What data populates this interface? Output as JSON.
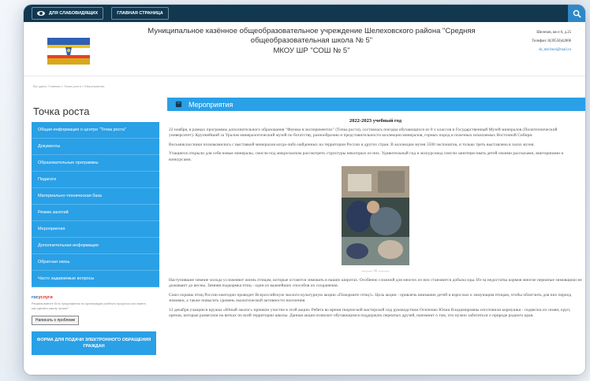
{
  "topbar": {
    "accessibility_label": "ДЛЯ СЛАБОВИДЯЩИХ",
    "home_label": "ГЛАВНАЯ СТРАНИЦА"
  },
  "header": {
    "school_name": "Муниципальное казённое общеобразовательное учреждение Шелеховского района \"Средняя общеобразовательная школа № 5\"",
    "short_name": "МКОУ ШР \"СОШ № 5\"",
    "address": "Шелехов, кв-л 6, д.25",
    "phone": "Телефон: 8(39550)42806",
    "email": "sh_mschool@mail.ru"
  },
  "breadcrumb": "Вы здесь: Главная  »  Точка роста  »  Мероприятия",
  "sidebar": {
    "title": "Точка роста",
    "items": [
      "Общая информация о центре \"Точка роста\"",
      "Документы",
      "Образовательные программы",
      "Педагоги",
      "Материально-техническая база",
      "Режим занятий",
      "Мероприятия",
      "Дополнительная информация",
      "Обратная связь",
      "Часто задаваемые вопросы"
    ],
    "gos_part1": "гос",
    "gos_part2": "услуги",
    "gos_text": "Решаем вместе\nЕсть предложения по организации учебного процесса или знаете, как сделать школу лучше?",
    "write_button": "Написать о проблеме",
    "feedback_button": "ФОРМА ДЛЯ ПОДАЧИ ЭЛЕКТРОННОГО ОБРАЩЕНИЯ ГРАЖДАН"
  },
  "main": {
    "title": "Мероприятия",
    "year": "2022-2023 учебный год",
    "paragraphs": [
      "22 ноября, в рамках программы дополнительного образования \"Физика в экспериментах\" (Точка роста), состоялась поездка обучающихся из 8 х классов в Государственный Музей минералов (Политехнический университет). Крупнейший за Уралом минералогический музей по богатству, разнообразию и представительности коллекции минералов, горных пород и полезных ископаемых Восточной Сибири.",
      "Восьмиклассники познакомились с выставкой минералов когда-либо найденных на территории России и других стран. В коллекции музея 3500 экспонатов, и только треть выставлена в залах музея.",
      "Учащиеся открыли для себя новые минералы, смогли под микроскопом рассмотреть структуры некоторых из них. Удивительный гид и экскурсовод смогли заинтересовать детей своими рассказами, викторинами и конкурсами."
    ],
    "paragraphs2": [
      "Наступившие зимние холода усложняют жизнь птицам, которые остаются зимовать в наших широтах. Особенно сложной для многих из них становится добыча еды. Из-за недостатка кормов многие пернатые зимовщики не доживают до весны. Зимняя подкормка птиц - один из важнейших способов их сохранения.",
      "Союз охраны птиц России ежегодно проводит Всероссийскую эколого-культурную акцию «Покормите птиц!». Цель акции - привлечь внимание детей и взрослых к зимующим птицам, чтобы облегчить для них период зимовки, а также повысить уровень экологической активности населения.",
      "12 декабря учащиеся кружка «Юный эколог» приняли участие в этой акции. Ребята во время творческой мастерской под руководством Осипенко Юлии Владимировны изготовили кормушки - подвески из семян, круп, орехов, которые развесили на ветках по всей территории школы. Данная акция позволит обучающимся поддержать пернатых друзей, напомнит о том, что нужно заботиться о природе родного края."
    ]
  }
}
